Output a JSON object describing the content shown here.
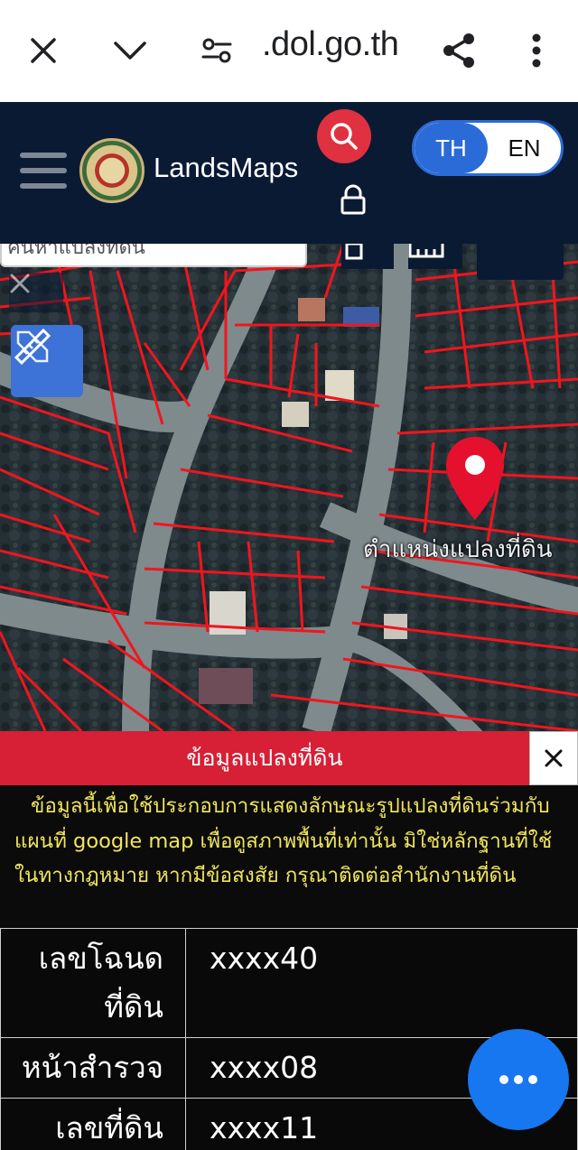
{
  "browser": {
    "url": ".dol.go.th",
    "icons": [
      "close-icon",
      "chevron-down-icon",
      "site-settings-icon",
      "share-icon",
      "more-vertical-icon"
    ]
  },
  "header": {
    "brand": "LandsMaps",
    "lang_th": "TH",
    "lang_en": "EN",
    "icons": [
      "menu-icon",
      "search-icon",
      "lock-icon"
    ]
  },
  "map": {
    "search_text": "ค้นหาแปลงที่ดิน",
    "parcel_label": "ตำแหน่งแปลงที่ดิน",
    "icons": [
      "close-icon",
      "measure-tool-icon",
      "layers-icon",
      "location-pin-icon"
    ]
  },
  "panel": {
    "title": "ข้อมูลแปลงที่ดิน",
    "notice": "ข้อมูลนี้เพื่อใช้ประกอบการแสดงลักษณะรูปแปลงที่ดินร่วมกับแผนที่ google map เพื่อดูสภาพพื้นที่เท่านั้น มิใช่หลักฐานที่ใช้ในทางกฎหมาย หากมีข้อสงสัย กรุณาติดต่อสำนักงานที่ดิน",
    "rows": [
      {
        "label": "เลขโฉนดที่ดิน",
        "value": "xxxx40"
      },
      {
        "label": "หน้าสำรวจ",
        "value": "xxxx08"
      },
      {
        "label": "เลขที่ดิน",
        "value": "xxxx11"
      }
    ]
  },
  "colors": {
    "header_bg": "#0b1a33",
    "accent_red": "#d71f35",
    "accent_blue": "#2b6bd8",
    "notice_text": "#f1e65c",
    "fab": "#1677f0"
  }
}
